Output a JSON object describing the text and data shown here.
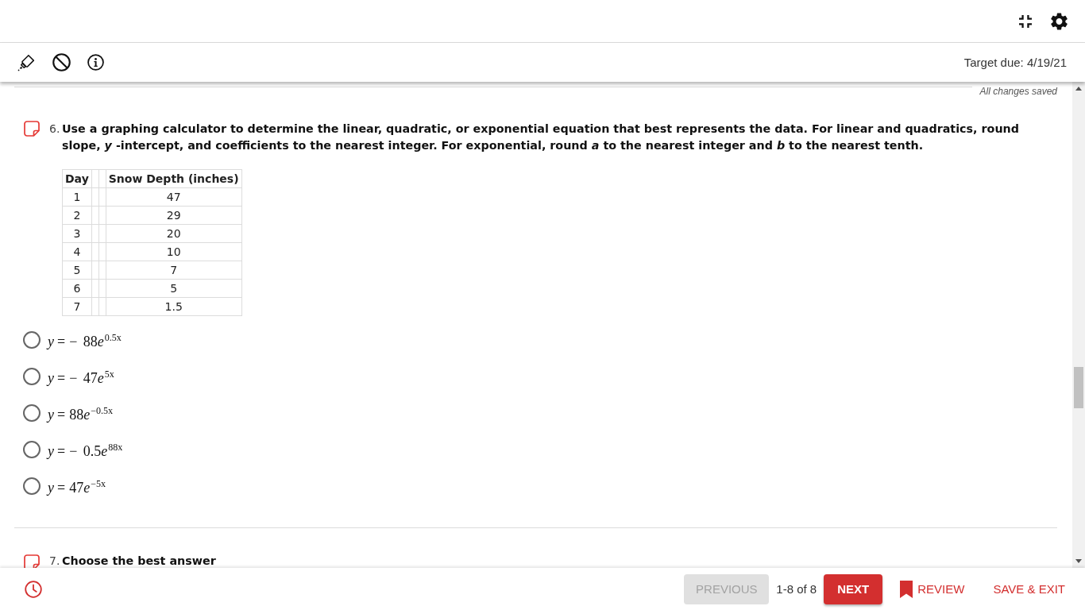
{
  "toolbar": {
    "target_due": "Target due: 4/19/21"
  },
  "save_status": "All changes saved",
  "questions": [
    {
      "number": "6.",
      "prompt": "Use a graphing calculator to determine the linear, quadratic, or exponential equation that best represents the data. For linear and quadratics, round slope, *y* -intercept, and coefficients to the nearest integer. For exponential, round *a* to the nearest integer and *b* to the nearest tenth.",
      "table": {
        "columns": [
          "Day",
          "Snow Depth (inches)"
        ],
        "rows": [
          [
            "1",
            "47"
          ],
          [
            "2",
            "29"
          ],
          [
            "3",
            "20"
          ],
          [
            "4",
            "10"
          ],
          [
            "5",
            "7"
          ],
          [
            "6",
            "5"
          ],
          [
            "7",
            "1.5"
          ]
        ]
      },
      "choices": [
        {
          "lhs": "y",
          "relation": "=",
          "coefficient": "− 88",
          "base": "e",
          "exponent": "0.5x",
          "selected": false
        },
        {
          "lhs": "y",
          "relation": "=",
          "coefficient": "− 47",
          "base": "e",
          "exponent": "5x",
          "selected": false
        },
        {
          "lhs": "y",
          "relation": "=",
          "coefficient": "88",
          "base": "e",
          "exponent": "−0.5x",
          "selected": false
        },
        {
          "lhs": "y",
          "relation": "=",
          "coefficient": "− 0.5",
          "base": "e",
          "exponent": "88x",
          "selected": false
        },
        {
          "lhs": "y",
          "relation": "=",
          "coefficient": "47",
          "base": "e",
          "exponent": "−5x",
          "selected": false
        }
      ]
    },
    {
      "number": "7.",
      "prompt": "Choose the best answer"
    }
  ],
  "footer": {
    "previous": {
      "label": "PREVIOUS",
      "disabled": true
    },
    "position": "1-8 of 8",
    "next": {
      "label": "NEXT"
    },
    "review": {
      "label": "REVIEW"
    },
    "save_exit": {
      "label": "SAVE & EXIT"
    }
  }
}
